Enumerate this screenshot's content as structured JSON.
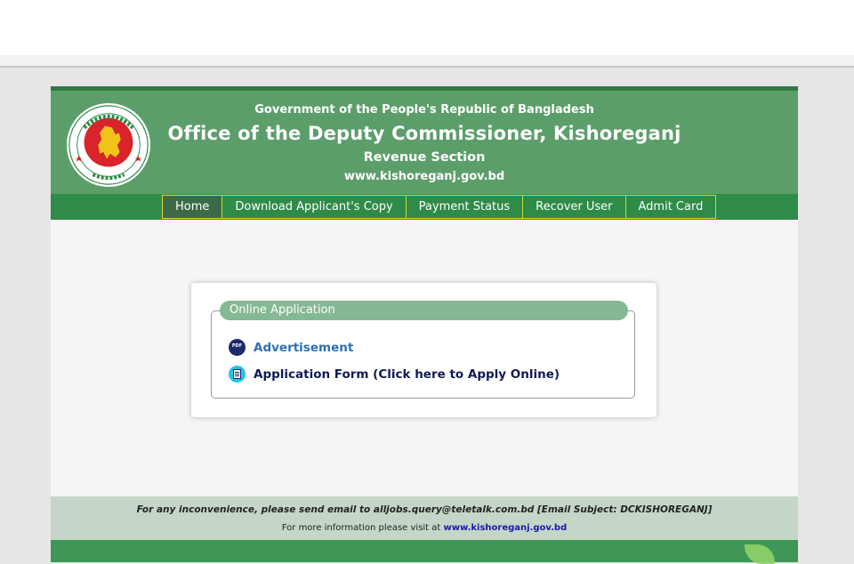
{
  "header": {
    "gov": "Government of the People's Republic of Bangladesh",
    "office": "Office of the Deputy Commissioner, Kishoreganj",
    "section": "Revenue Section",
    "website": "www.kishoreganj.gov.bd",
    "logo_icon": "bangladesh-govt-seal-icon"
  },
  "nav": {
    "items": [
      {
        "label": "Home"
      },
      {
        "label": "Download Applicant's Copy"
      },
      {
        "label": "Payment Status"
      },
      {
        "label": "Recover User"
      },
      {
        "label": "Admit Card"
      }
    ]
  },
  "panel": {
    "legend": "Online Application",
    "links": [
      {
        "label": "Advertisement",
        "icon": "pdf-icon"
      },
      {
        "label": "Application Form (Click here to Apply Online)",
        "icon": "form-icon"
      }
    ]
  },
  "footer": {
    "line1": "For any inconvenience, please send email to alljobs.query@teletalk.com.bd [Email Subject: DCKISHOREGANJ]",
    "line2_prefix": "For more information please visit at",
    "line2_site": "www.kishoreganj.gov.bd"
  },
  "colors": {
    "header_green": "#5c9e6a",
    "nav_green": "#2e8b48",
    "nav_border": "#d9d437",
    "legend_green": "#85b994",
    "footer_bg": "#c5d6c9"
  }
}
